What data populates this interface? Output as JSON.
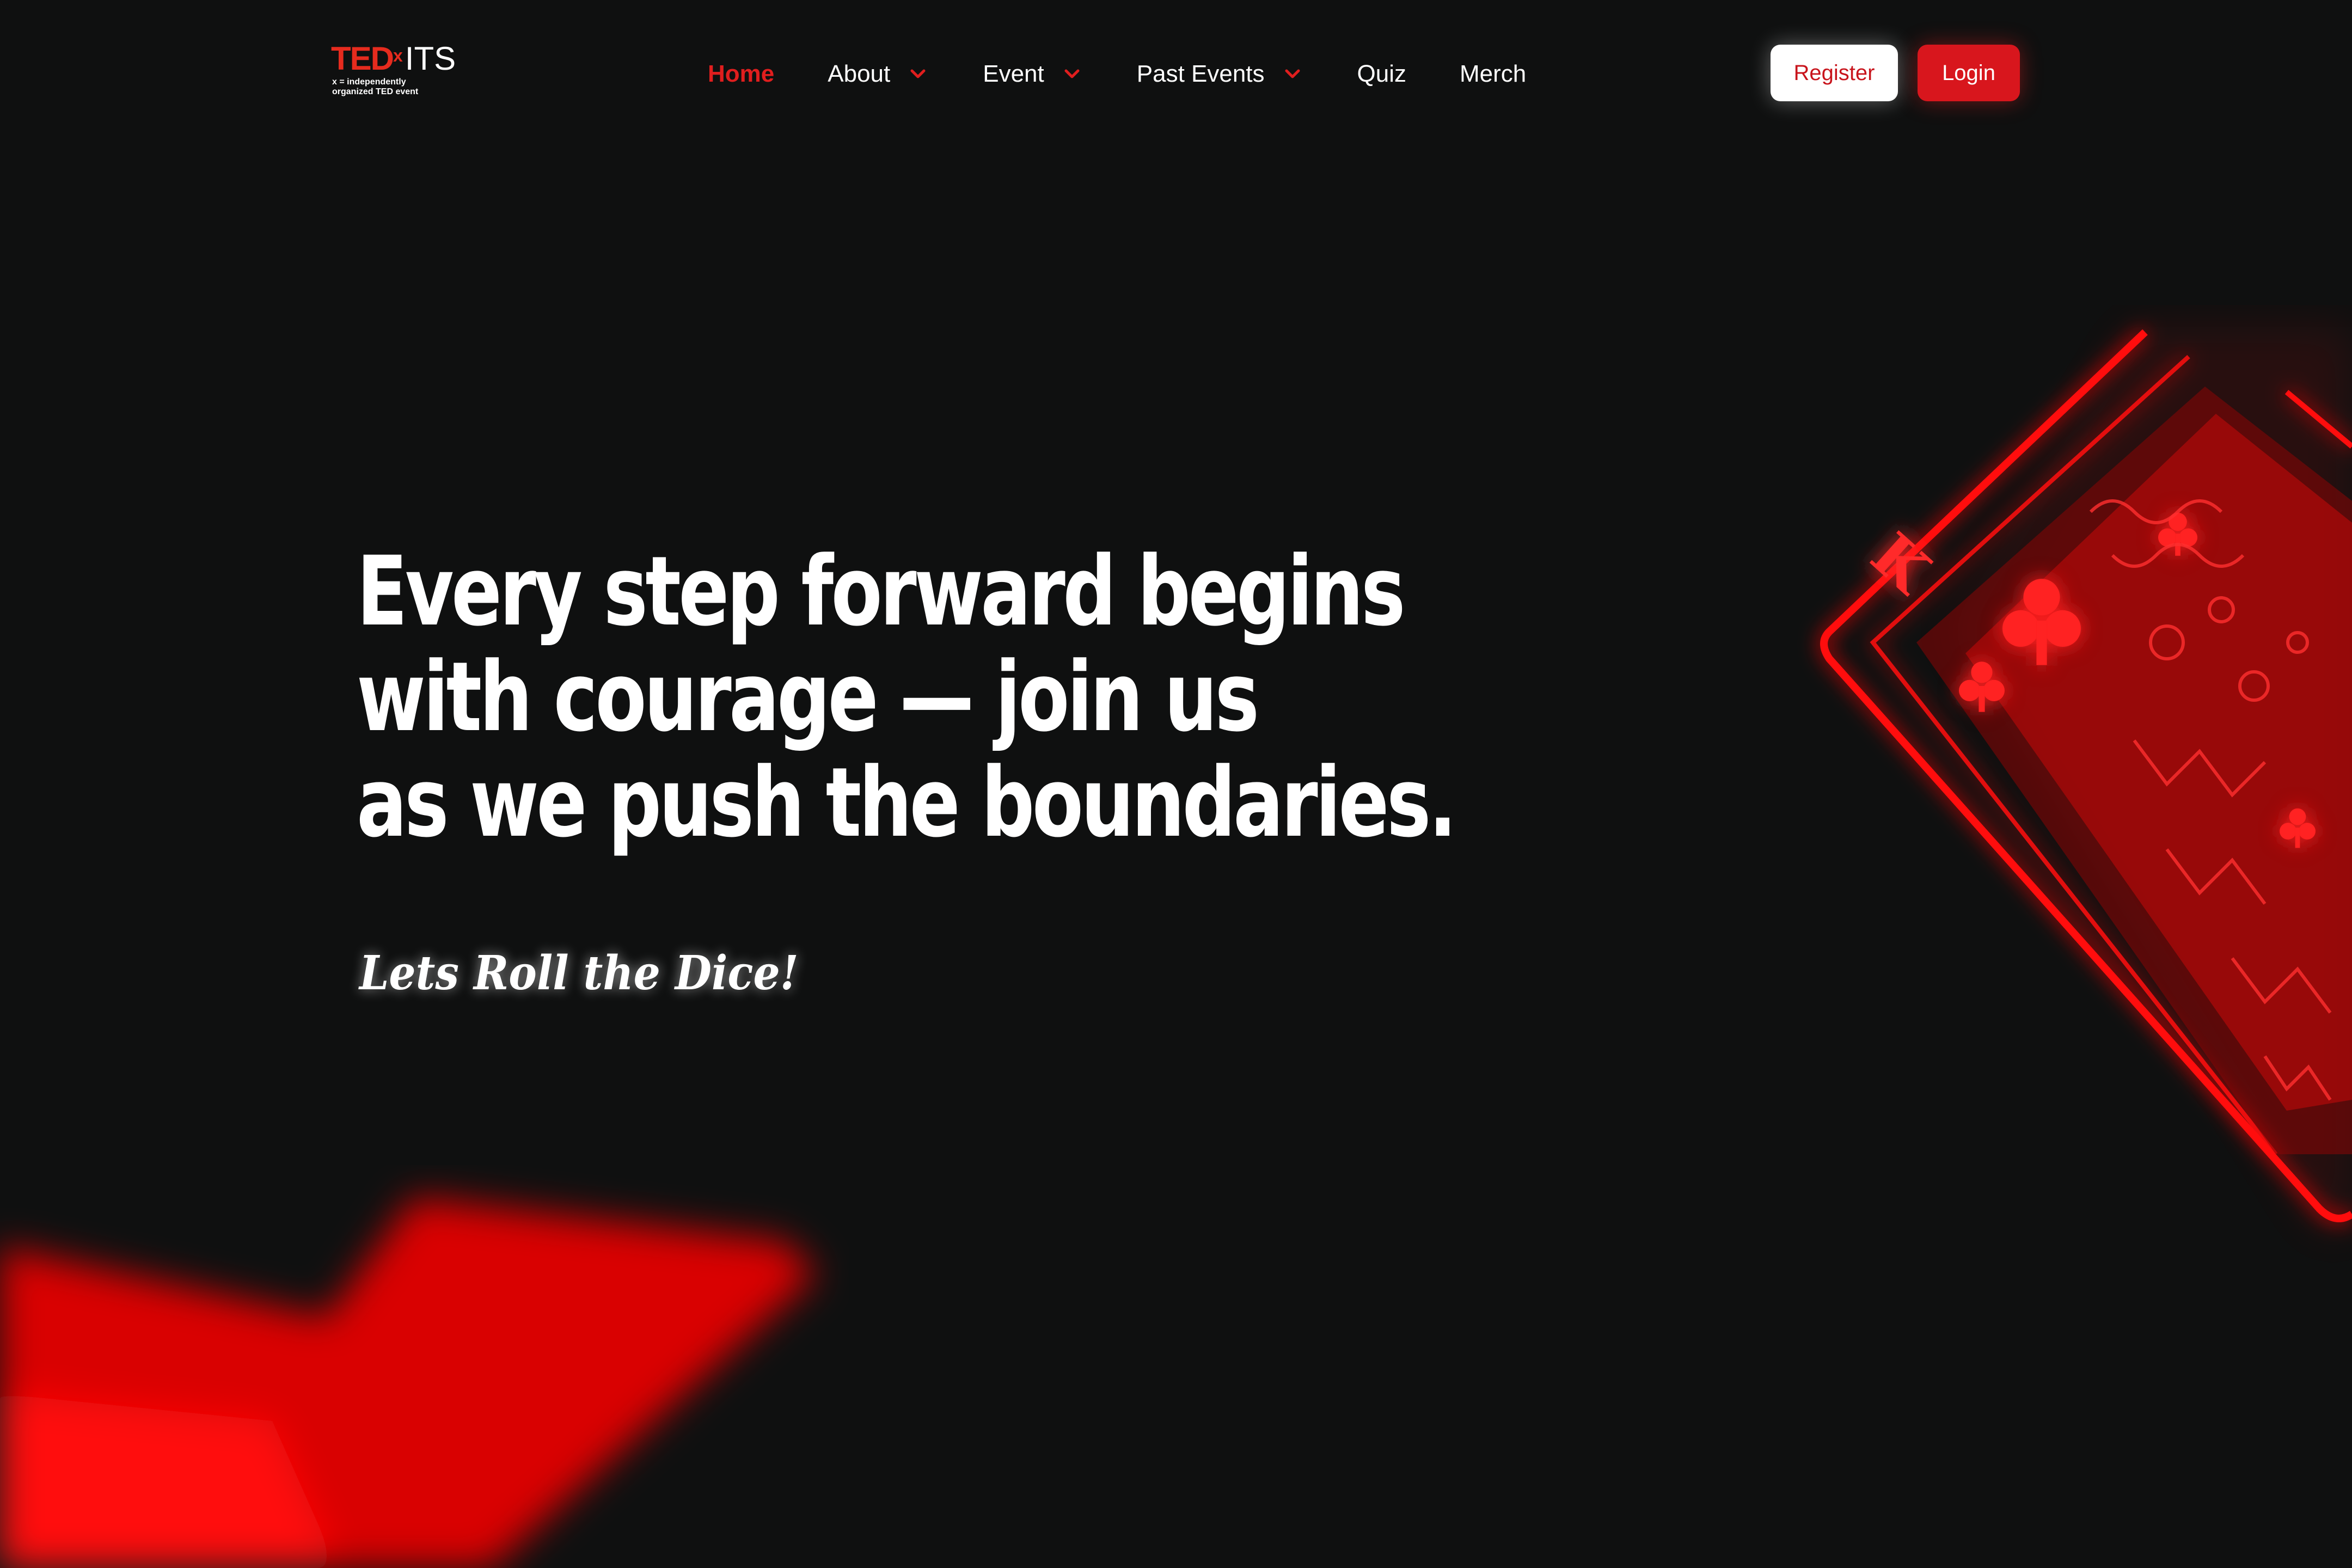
{
  "brand": {
    "logo_ted": "TED",
    "logo_x": "x",
    "logo_its": "ITS",
    "logo_sub": "x = independently\norganized TED event"
  },
  "nav": {
    "items": [
      {
        "label": "Home",
        "active": true,
        "dropdown": false
      },
      {
        "label": "About",
        "active": false,
        "dropdown": true
      },
      {
        "label": "Event",
        "active": false,
        "dropdown": true
      },
      {
        "label": "Past Events",
        "active": false,
        "dropdown": true
      },
      {
        "label": "Quiz",
        "active": false,
        "dropdown": false
      },
      {
        "label": "Merch",
        "active": false,
        "dropdown": false
      }
    ],
    "register_label": "Register",
    "login_label": "Login"
  },
  "hero": {
    "title_lines": [
      "Every step forward begins",
      "with courage —  join us",
      "as we push the boundaries."
    ],
    "tagline": "Lets Roll the Dice!"
  },
  "colors": {
    "background": "#0f1010",
    "accent": "#e01e1e",
    "text": "#ffffff"
  },
  "icons": {
    "dropdown": "chevron-down-icon",
    "decoration_card": "playing-card-king-of-clubs",
    "decoration_blob": "red-glow"
  }
}
